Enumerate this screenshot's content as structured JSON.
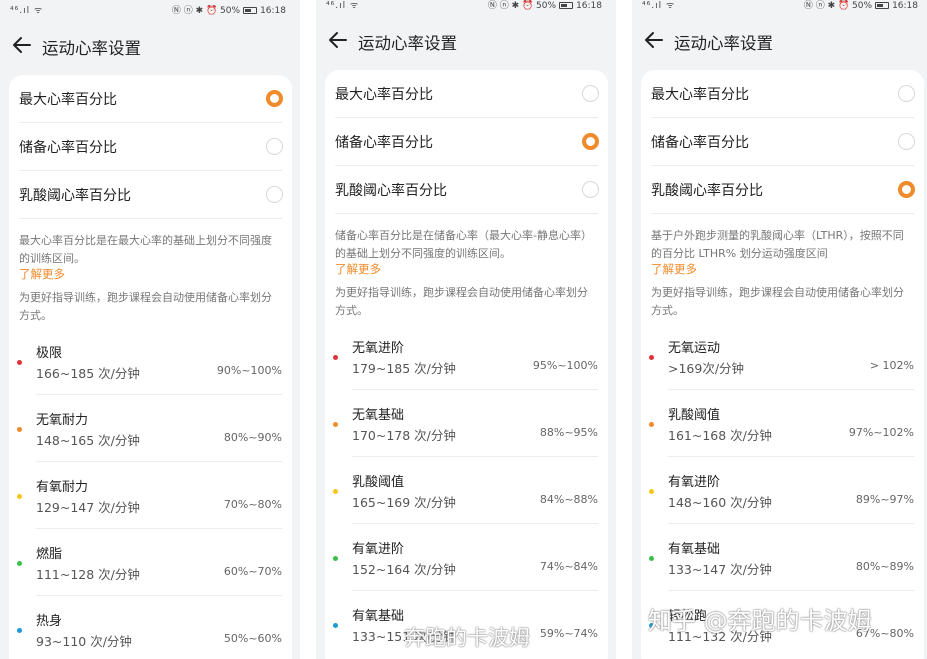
{
  "accent_color": "#f08a2a",
  "icons": [
    "back-arrow-icon",
    "signal-icon",
    "wifi-icon",
    "battery-icon",
    "radio-button-icon"
  ],
  "screens": [
    {
      "status": {
        "left": "⁴⁶.ıl ᯤ",
        "right": "Ⓝ ⓝ ✱ ⏰ 50%",
        "time": "16:18"
      },
      "title": "运动心率设置",
      "options": [
        {
          "label": "最大心率百分比",
          "selected": true
        },
        {
          "label": "储备心率百分比",
          "selected": false
        },
        {
          "label": "乳酸阈心率百分比",
          "selected": false
        }
      ],
      "description": "最大心率百分比是在最大心率的基础上划分不同强度的训练区间。",
      "more": "了解更多",
      "hint": "为更好指导训练，跑步课程会自动使用储备心率划分方式。",
      "zones": [
        {
          "name": "极限",
          "bpm": "166~185 次/分钟",
          "pct": "90%~100%",
          "color": "#e0323b"
        },
        {
          "name": "无氧耐力",
          "bpm": "148~165 次/分钟",
          "pct": "80%~90%",
          "color": "#f08a2a"
        },
        {
          "name": "有氧耐力",
          "bpm": "129~147 次/分钟",
          "pct": "70%~80%",
          "color": "#f5c518"
        },
        {
          "name": "燃脂",
          "bpm": "111~128 次/分钟",
          "pct": "60%~70%",
          "color": "#3cbf4a"
        },
        {
          "name": "热身",
          "bpm": "93~110 次/分钟",
          "pct": "50%~60%",
          "color": "#1a9ad6"
        }
      ]
    },
    {
      "status": {
        "left": "⁴⁶.ıl ᯤ",
        "right": "Ⓝ ⓝ ✱ ⏰ 50%",
        "time": "16:18"
      },
      "title": "运动心率设置",
      "options": [
        {
          "label": "最大心率百分比",
          "selected": false
        },
        {
          "label": "储备心率百分比",
          "selected": true
        },
        {
          "label": "乳酸阈心率百分比",
          "selected": false
        }
      ],
      "description": "储备心率百分比是在储备心率（最大心率-静息心率）的基础上划分不同强度的训练区间。",
      "more": "了解更多",
      "hint": "为更好指导训练，跑步课程会自动使用储备心率划分方式。",
      "zones": [
        {
          "name": "无氧进阶",
          "bpm": "179~185 次/分钟",
          "pct": "95%~100%",
          "color": "#e0323b"
        },
        {
          "name": "无氧基础",
          "bpm": "170~178 次/分钟",
          "pct": "88%~95%",
          "color": "#f08a2a"
        },
        {
          "name": "乳酸阈值",
          "bpm": "165~169 次/分钟",
          "pct": "84%~88%",
          "color": "#f5c518"
        },
        {
          "name": "有氧进阶",
          "bpm": "152~164 次/分钟",
          "pct": "74%~84%",
          "color": "#3cbf4a"
        },
        {
          "name": "有氧基础",
          "bpm": "133~151 次/分钟",
          "pct": "59%~74%",
          "color": "#1a9ad6"
        }
      ]
    },
    {
      "status": {
        "left": "⁴⁶.ıl ᯤ",
        "right": "Ⓝ ⓝ ✱ ⏰ 50%",
        "time": "16:18"
      },
      "title": "运动心率设置",
      "options": [
        {
          "label": "最大心率百分比",
          "selected": false
        },
        {
          "label": "储备心率百分比",
          "selected": false
        },
        {
          "label": "乳酸阈心率百分比",
          "selected": true
        }
      ],
      "description": "基于户外跑步测量的乳酸阈心率（LTHR），按照不同的百分比 LTHR% 划分运动强度区间",
      "more": "了解更多",
      "hint": "为更好指导训练，跑步课程会自动使用储备心率划分方式。",
      "zones": [
        {
          "name": "无氧运动",
          "bpm": ">169次/分钟",
          "pct": "> 102%",
          "color": "#e0323b"
        },
        {
          "name": "乳酸阈值",
          "bpm": "161~168 次/分钟",
          "pct": "97%~102%",
          "color": "#f08a2a"
        },
        {
          "name": "有氧进阶",
          "bpm": "148~160 次/分钟",
          "pct": "89%~97%",
          "color": "#f5c518"
        },
        {
          "name": "有氧基础",
          "bpm": "133~147 次/分钟",
          "pct": "80%~89%",
          "color": "#3cbf4a"
        },
        {
          "name": "轻松跑",
          "bpm": "111~132 次/分钟",
          "pct": "67%~80%",
          "color": "#1a9ad6"
        }
      ]
    }
  ],
  "watermarks": {
    "center": "奔跑的卡波姆",
    "right": "知乎 @奔跑的卡波姆"
  }
}
